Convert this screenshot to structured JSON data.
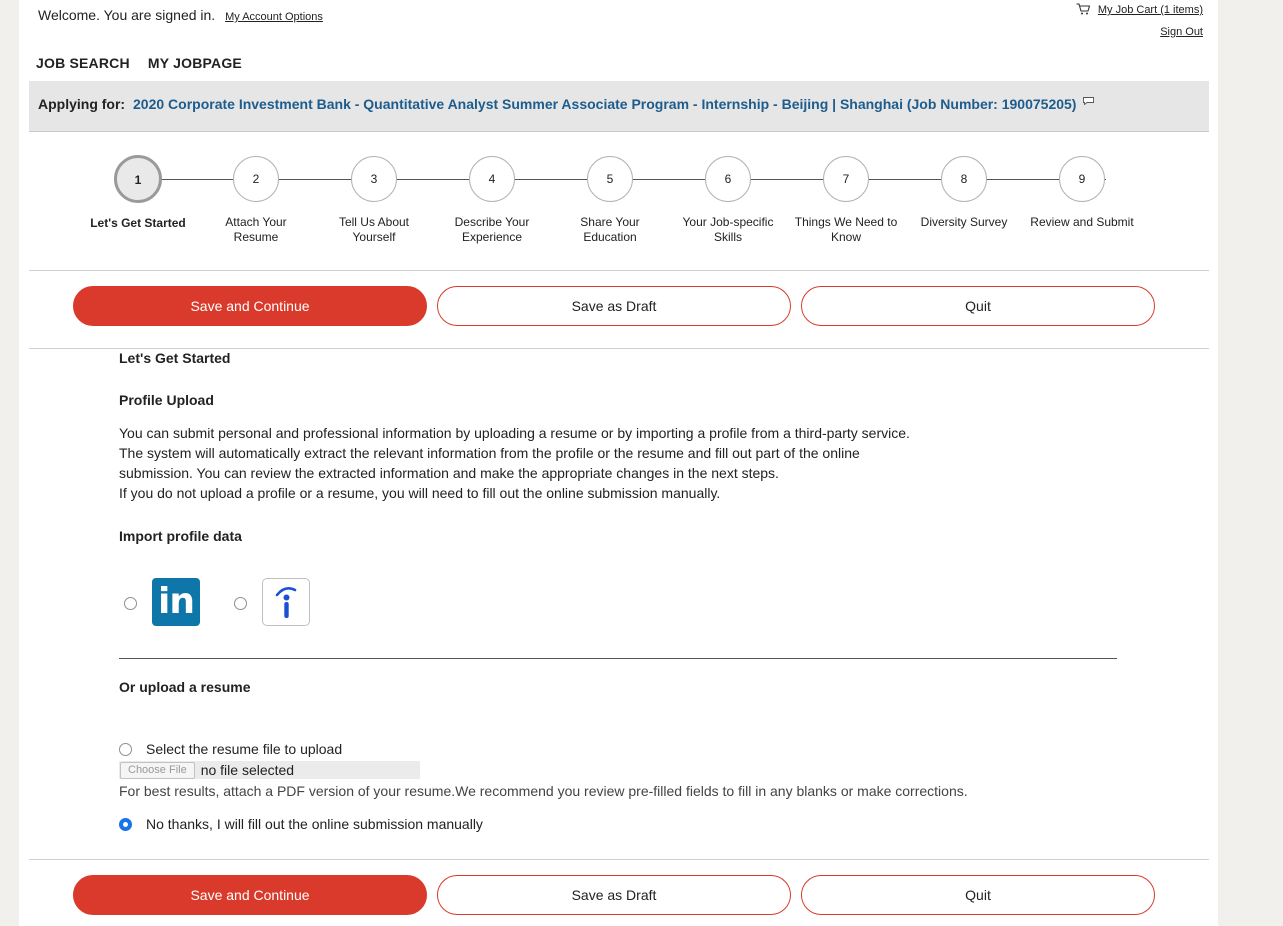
{
  "header": {
    "welcome_text": "Welcome. You are signed in.",
    "account_link": "My Account Options",
    "cart_link": "My Job Cart (1 items)",
    "signout_link": "Sign Out"
  },
  "nav": {
    "job_search": "JOB SEARCH",
    "my_jobpage": "MY JOBPAGE"
  },
  "applying": {
    "label": "Applying for:",
    "job_title": "2020 Corporate Investment Bank - Quantitative Analyst Summer Associate Program - Internship - Beijing | Shanghai (Job Number: 190075205)"
  },
  "steps": [
    {
      "number": "1",
      "label_line1": "Let's Get Started",
      "label_line2": "",
      "active": true
    },
    {
      "number": "2",
      "label_line1": "Attach Your",
      "label_line2": "Resume",
      "active": false
    },
    {
      "number": "3",
      "label_line1": "Tell Us About",
      "label_line2": "Yourself",
      "active": false
    },
    {
      "number": "4",
      "label_line1": "Describe Your",
      "label_line2": "Experience",
      "active": false
    },
    {
      "number": "5",
      "label_line1": "Share Your",
      "label_line2": "Education",
      "active": false
    },
    {
      "number": "6",
      "label_line1": "Your Job-specific",
      "label_line2": "Skills",
      "active": false
    },
    {
      "number": "7",
      "label_line1": "Things We Need to",
      "label_line2": "Know",
      "active": false
    },
    {
      "number": "8",
      "label_line1": "Diversity Survey",
      "label_line2": "",
      "active": false
    },
    {
      "number": "9",
      "label_line1": "Review and Submit",
      "label_line2": "",
      "active": false
    }
  ],
  "buttons": {
    "save_continue": "Save and Continue",
    "save_draft": "Save as Draft",
    "quit": "Quit"
  },
  "content": {
    "section_title": "Let's Get Started",
    "profile_upload_title": "Profile Upload",
    "paragraph_lines": [
      "You can submit personal and professional information by uploading a resume or by importing a profile from a third-party service.",
      "The system will automatically extract the relevant information from the profile or the resume and fill out part of the online",
      "submission. You can review the extracted information and make the appropriate changes in the next steps.",
      "If you do not upload a profile or a resume, you will need to fill out the online submission manually."
    ],
    "import_title": "Import profile data",
    "linkedin_text": "in",
    "upload_title": "Or upload a resume",
    "option_upload": "Select the resume file to upload",
    "choose_file": "Choose File",
    "no_file": "no file selected",
    "hint": "For best results, attach a PDF version of your resume.We recommend you review pre-filled fields to fill in any blanks or make corrections.",
    "option_manual": "No thanks, I will fill out the online submission manually"
  },
  "colors": {
    "primary_red": "#d93a2b",
    "job_link_blue": "#1d5c8c",
    "linkedin_blue": "#0e76a8",
    "radio_blue": "#1a73e8"
  },
  "icons": [
    "cart-icon",
    "comment-bubble-icon",
    "linkedin-icon",
    "indeed-icon"
  ]
}
